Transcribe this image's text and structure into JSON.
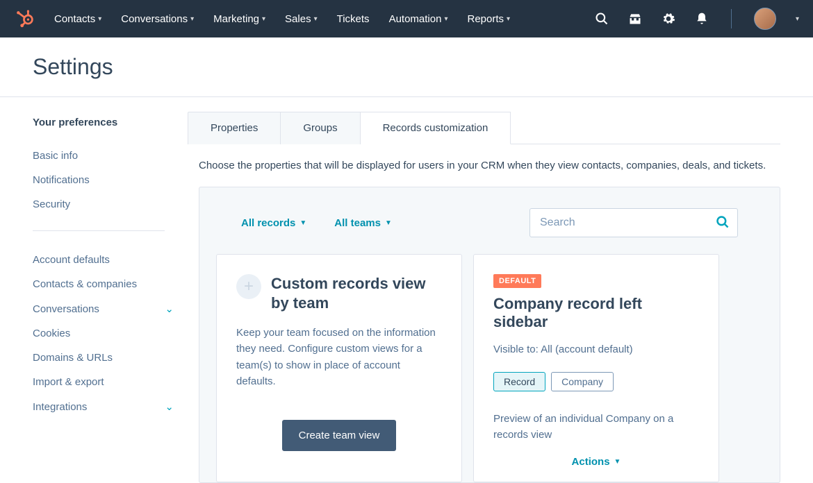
{
  "nav": {
    "items": [
      "Contacts",
      "Conversations",
      "Marketing",
      "Sales",
      "Tickets",
      "Automation",
      "Reports"
    ],
    "item_has_dropdown": [
      true,
      true,
      true,
      true,
      false,
      true,
      true
    ]
  },
  "page_title": "Settings",
  "sidebar": {
    "section1_title": "Your preferences",
    "section1": [
      "Basic info",
      "Notifications",
      "Security"
    ],
    "section2": [
      "Account defaults",
      "Contacts & companies",
      "Conversations",
      "Cookies",
      "Domains & URLs",
      "Import & export",
      "Integrations"
    ],
    "expandable": [
      false,
      false,
      true,
      false,
      false,
      false,
      true
    ]
  },
  "tabs": [
    "Properties",
    "Groups",
    "Records customization"
  ],
  "active_tab": 2,
  "description": "Choose the properties that will be displayed for users in your CRM when they view contacts, companies, deals, and tickets.",
  "filters": {
    "records": "All records",
    "teams": "All teams"
  },
  "search_placeholder": "Search",
  "card1": {
    "title": "Custom records view by team",
    "desc": "Keep your team focused on the information they need. Configure custom views for a team(s) to show in place of account defaults.",
    "button": "Create team view"
  },
  "card2": {
    "badge": "DEFAULT",
    "title": "Company record left sidebar",
    "visible_to": "Visible to: All (account default)",
    "tags": [
      "Record",
      "Company"
    ],
    "preview": "Preview of an individual Company on a records view",
    "actions": "Actions"
  }
}
